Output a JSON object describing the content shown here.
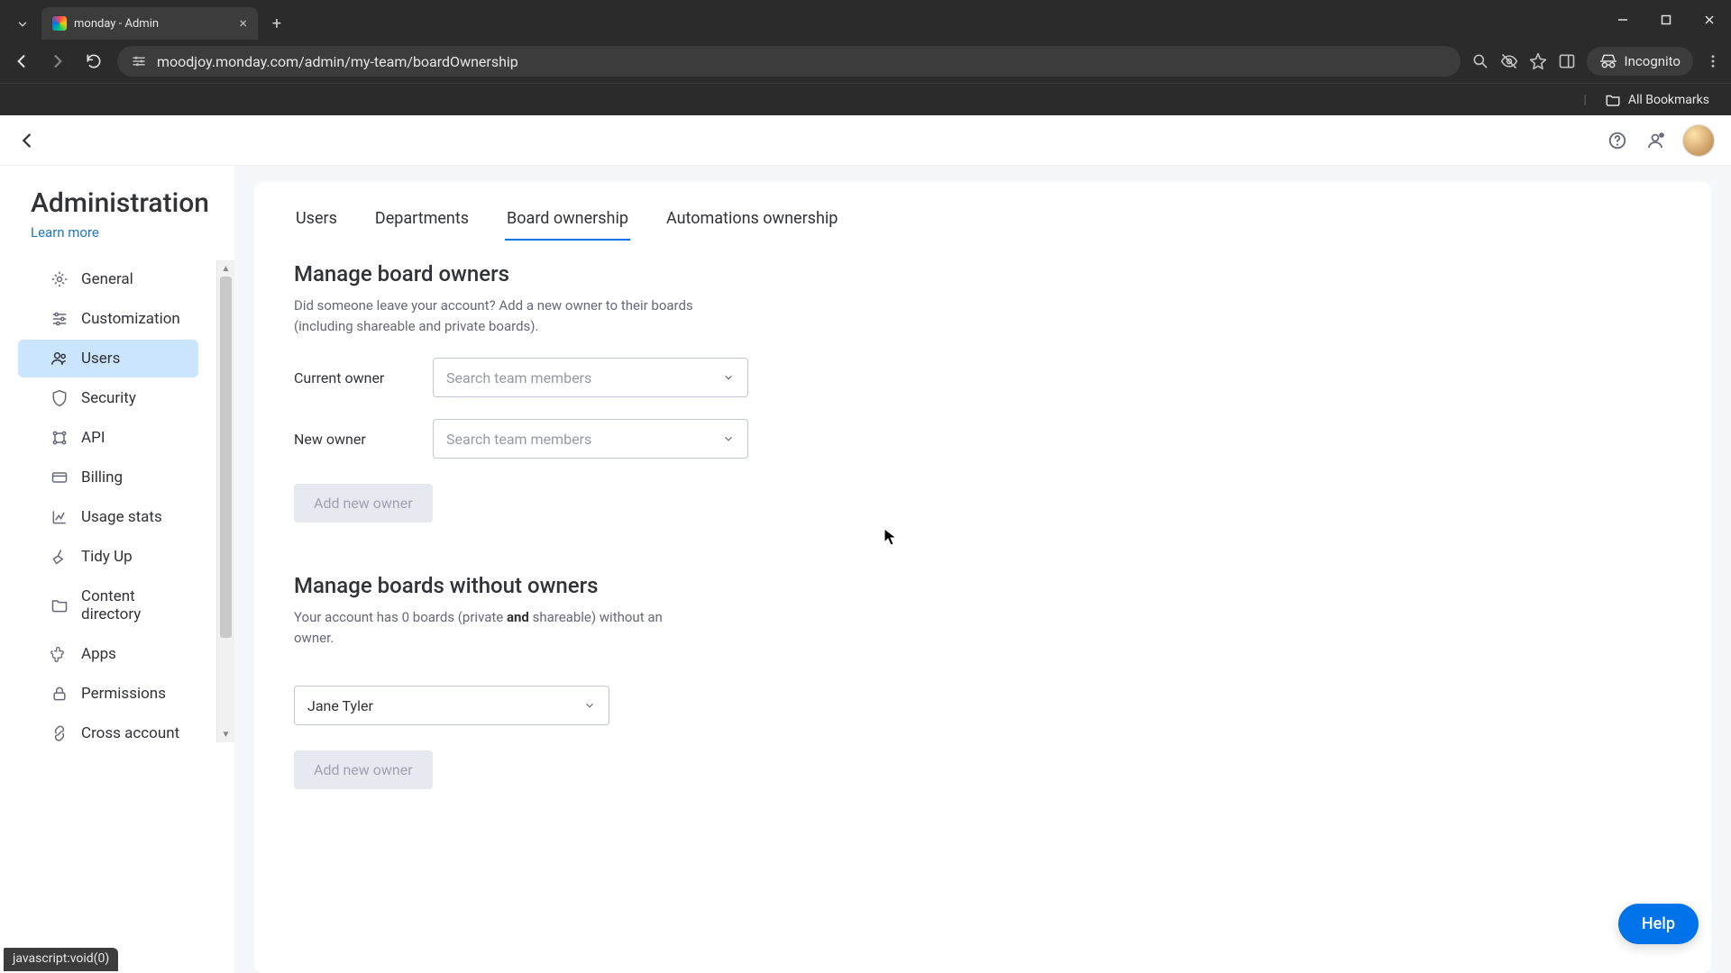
{
  "browser": {
    "tab_title": "monday - Admin",
    "url": "moodjoy.monday.com/admin/my-team/boardOwnership",
    "incognito_label": "Incognito",
    "all_bookmarks": "All Bookmarks",
    "status_text": "javascript:void(0)"
  },
  "topbar": {},
  "sidebar": {
    "title": "Administration",
    "learn_more": "Learn more",
    "items": [
      {
        "id": "general",
        "label": "General",
        "icon": "gear-icon"
      },
      {
        "id": "customization",
        "label": "Customization",
        "icon": "sliders-icon"
      },
      {
        "id": "users",
        "label": "Users",
        "icon": "users-icon",
        "active": true
      },
      {
        "id": "security",
        "label": "Security",
        "icon": "shield-icon"
      },
      {
        "id": "api",
        "label": "API",
        "icon": "api-icon"
      },
      {
        "id": "billing",
        "label": "Billing",
        "icon": "card-icon"
      },
      {
        "id": "usage-stats",
        "label": "Usage stats",
        "icon": "chart-icon"
      },
      {
        "id": "tidy-up",
        "label": "Tidy Up",
        "icon": "broom-icon"
      },
      {
        "id": "content-directory",
        "label": "Content directory",
        "icon": "folder-icon"
      },
      {
        "id": "apps",
        "label": "Apps",
        "icon": "puzzle-icon"
      },
      {
        "id": "permissions",
        "label": "Permissions",
        "icon": "lock-icon"
      },
      {
        "id": "cross-account",
        "label": "Cross account",
        "icon": "link-icon"
      }
    ]
  },
  "tabs": {
    "items": [
      {
        "id": "users",
        "label": "Users"
      },
      {
        "id": "departments",
        "label": "Departments"
      },
      {
        "id": "ownership",
        "label": "Board ownership",
        "active": true
      },
      {
        "id": "automations",
        "label": "Automations ownership"
      }
    ]
  },
  "section1": {
    "title": "Manage board owners",
    "desc": "Did someone leave your account? Add a new owner to their boards (including shareable and private boards).",
    "current_owner_label": "Current owner",
    "new_owner_label": "New owner",
    "select_placeholder": "Search team members",
    "button": "Add new owner"
  },
  "section2": {
    "title": "Manage boards without owners",
    "desc_pre": "Your account has 0 boards (private ",
    "desc_bold": "and",
    "desc_post": " shareable) without an owner.",
    "select_value": "Jane Tyler",
    "button": "Add new owner"
  },
  "help_label": "Help"
}
